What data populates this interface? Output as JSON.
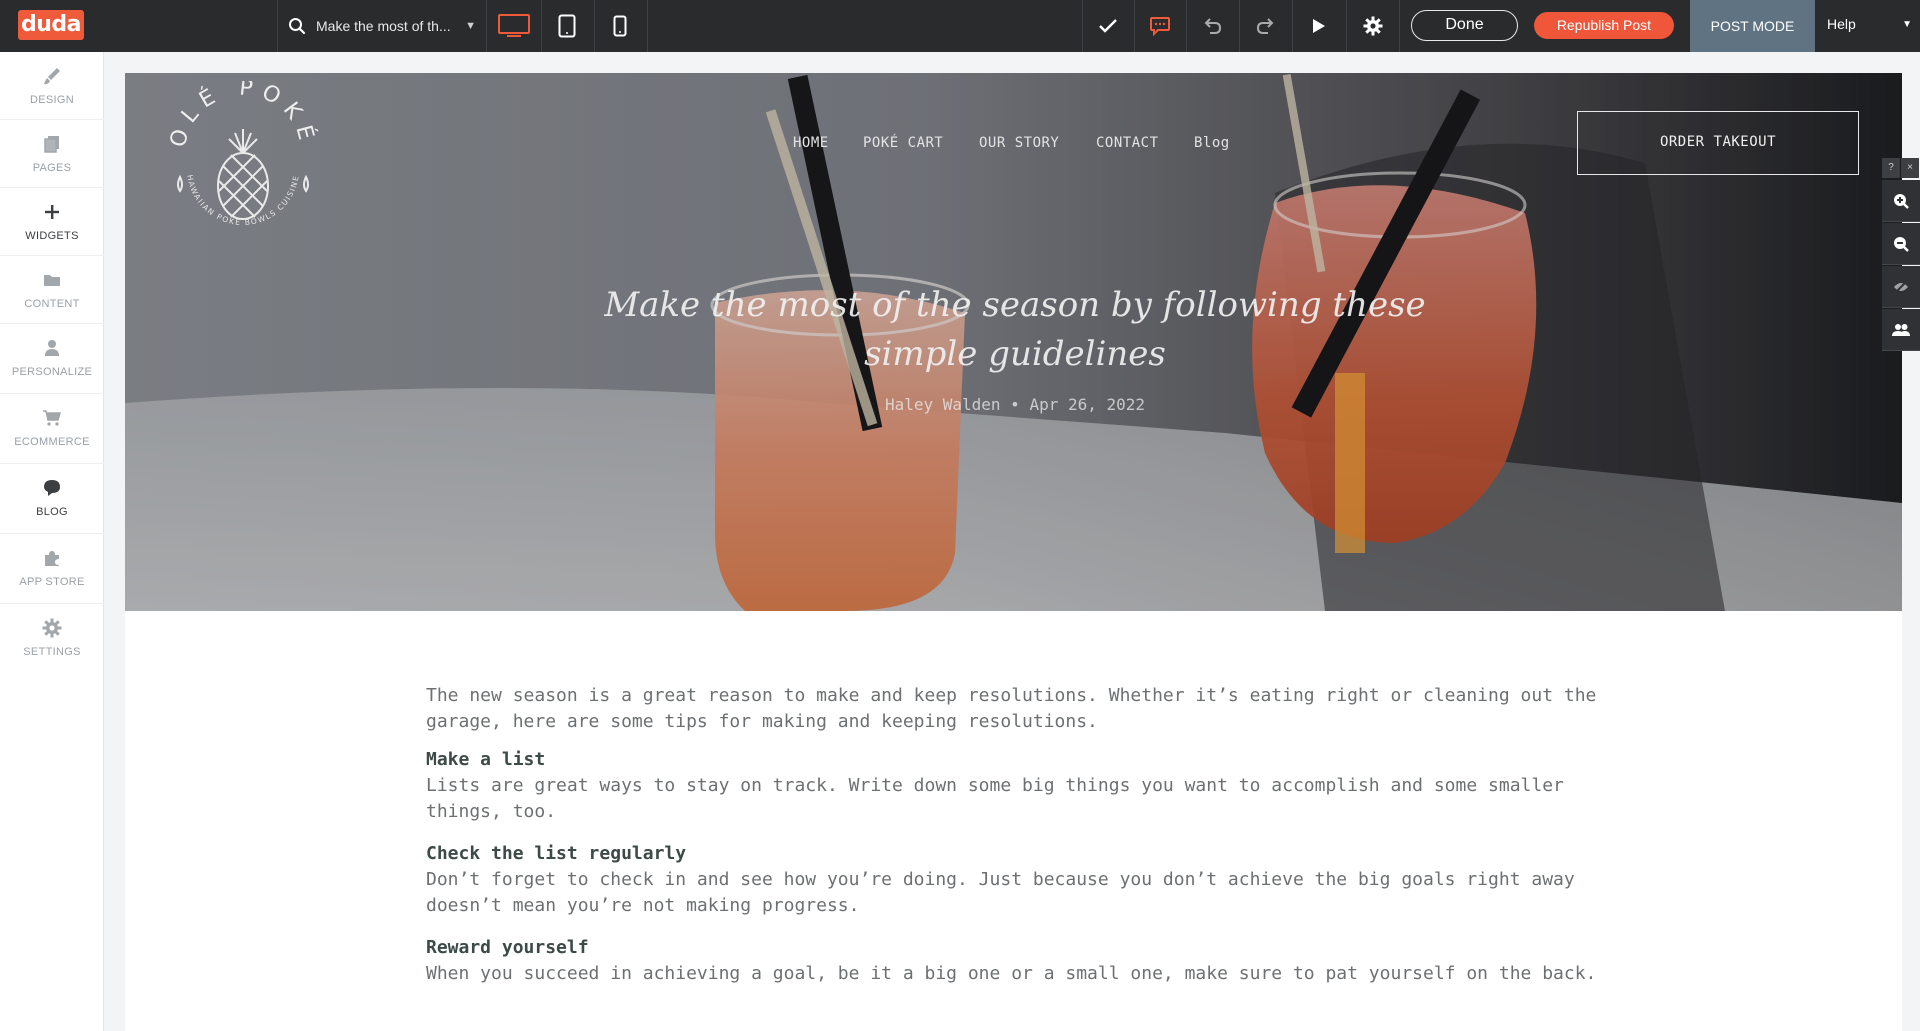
{
  "topbar": {
    "logo": "duda",
    "page_selector": "Make the most of th...",
    "done_label": "Done",
    "republish_label": "Republish Post",
    "mode_label": "POST MODE",
    "help_label": "Help",
    "accent_color": "#f0573a"
  },
  "sidebar": {
    "items": [
      {
        "label": "DESIGN",
        "icon": "brush-icon"
      },
      {
        "label": "PAGES",
        "icon": "pages-icon"
      },
      {
        "label": "WIDGETS",
        "icon": "plus-icon"
      },
      {
        "label": "CONTENT",
        "icon": "folder-icon"
      },
      {
        "label": "PERSONALIZE",
        "icon": "person-icon"
      },
      {
        "label": "ECOMMERCE",
        "icon": "cart-icon"
      },
      {
        "label": "BLOG",
        "icon": "chat-bubble-icon"
      },
      {
        "label": "APP STORE",
        "icon": "puzzle-icon"
      },
      {
        "label": "SETTINGS",
        "icon": "gear-icon"
      }
    ]
  },
  "site": {
    "logo_text": "OLÉ POKÉ",
    "logo_subtext": "HAWAIIAN POKE BOWLS CUISINE",
    "nav": [
      "HOME",
      "POKÉ CART",
      "OUR STORY",
      "CONTACT",
      "Blog"
    ],
    "order_button": "ORDER TAKEOUT",
    "hero_title": "Make the most of the season by following these simple guidelines",
    "hero_meta": "Haley Walden • Apr 26, 2022"
  },
  "article": {
    "intro": "The new season is a great reason to make and keep resolutions. Whether it’s eating right or cleaning out the garage, here are some tips for making and keeping resolutions.",
    "sections": [
      {
        "heading": "Make a list",
        "body": "Lists are great ways to stay on track. Write down some big things you want to accomplish and some smaller things, too."
      },
      {
        "heading": "Check the list regularly",
        "body": "Don’t forget to check in and see how you’re doing. Just because you don’t achieve the big goals right away doesn’t mean you’re not making progress."
      },
      {
        "heading": "Reward yourself",
        "body": "When you succeed in achieving a goal, be it a big one or a small one, make sure to pat yourself on the back."
      }
    ]
  },
  "float_tools": {
    "mini": [
      "?",
      "×"
    ]
  }
}
